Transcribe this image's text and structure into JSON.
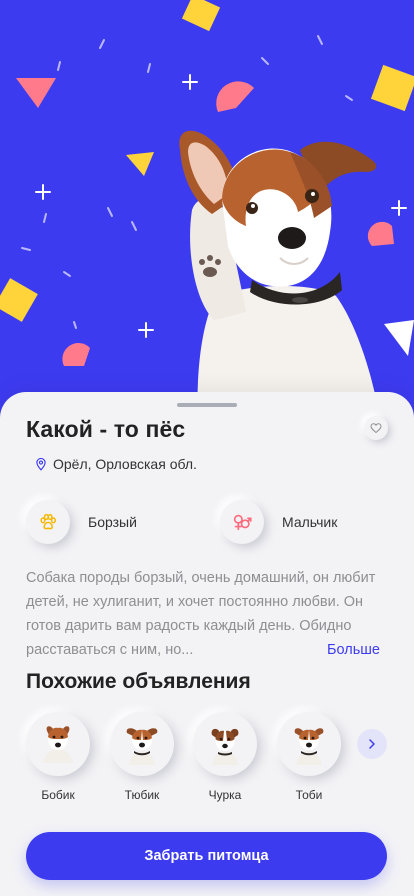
{
  "pet": {
    "name": "Какой - то пёс",
    "location": "Орёл, Орловская обл.",
    "breed": "Борзый",
    "sex": "Мальчик",
    "description": "Собака породы борзый, очень домашний, он любит детей, не хулиганит, и хочет постоянно любви. Он готов дарить вам радость каждый день. Обидно расставаться с ним, но...",
    "more_label": "Больше"
  },
  "similar": {
    "title": "Похожие объявления",
    "items": [
      {
        "name": "Бобик"
      },
      {
        "name": "Тюбик"
      },
      {
        "name": "Чурка"
      },
      {
        "name": "Тоби"
      }
    ]
  },
  "cta": {
    "label": "Забрать питомца"
  },
  "colors": {
    "accent": "#3d3bf0",
    "hero_bg": "#3d3bf0",
    "confetti_yellow": "#ffd43b",
    "confetti_pink": "#ff7b8c",
    "sex_icon": "#ff6b7d",
    "breed_icon": "#f5b800"
  },
  "icons": {
    "favorite": "heart-icon",
    "location": "location-pin-icon",
    "breed": "paw-icon",
    "sex": "gender-icon",
    "next": "chevron-right-icon"
  }
}
